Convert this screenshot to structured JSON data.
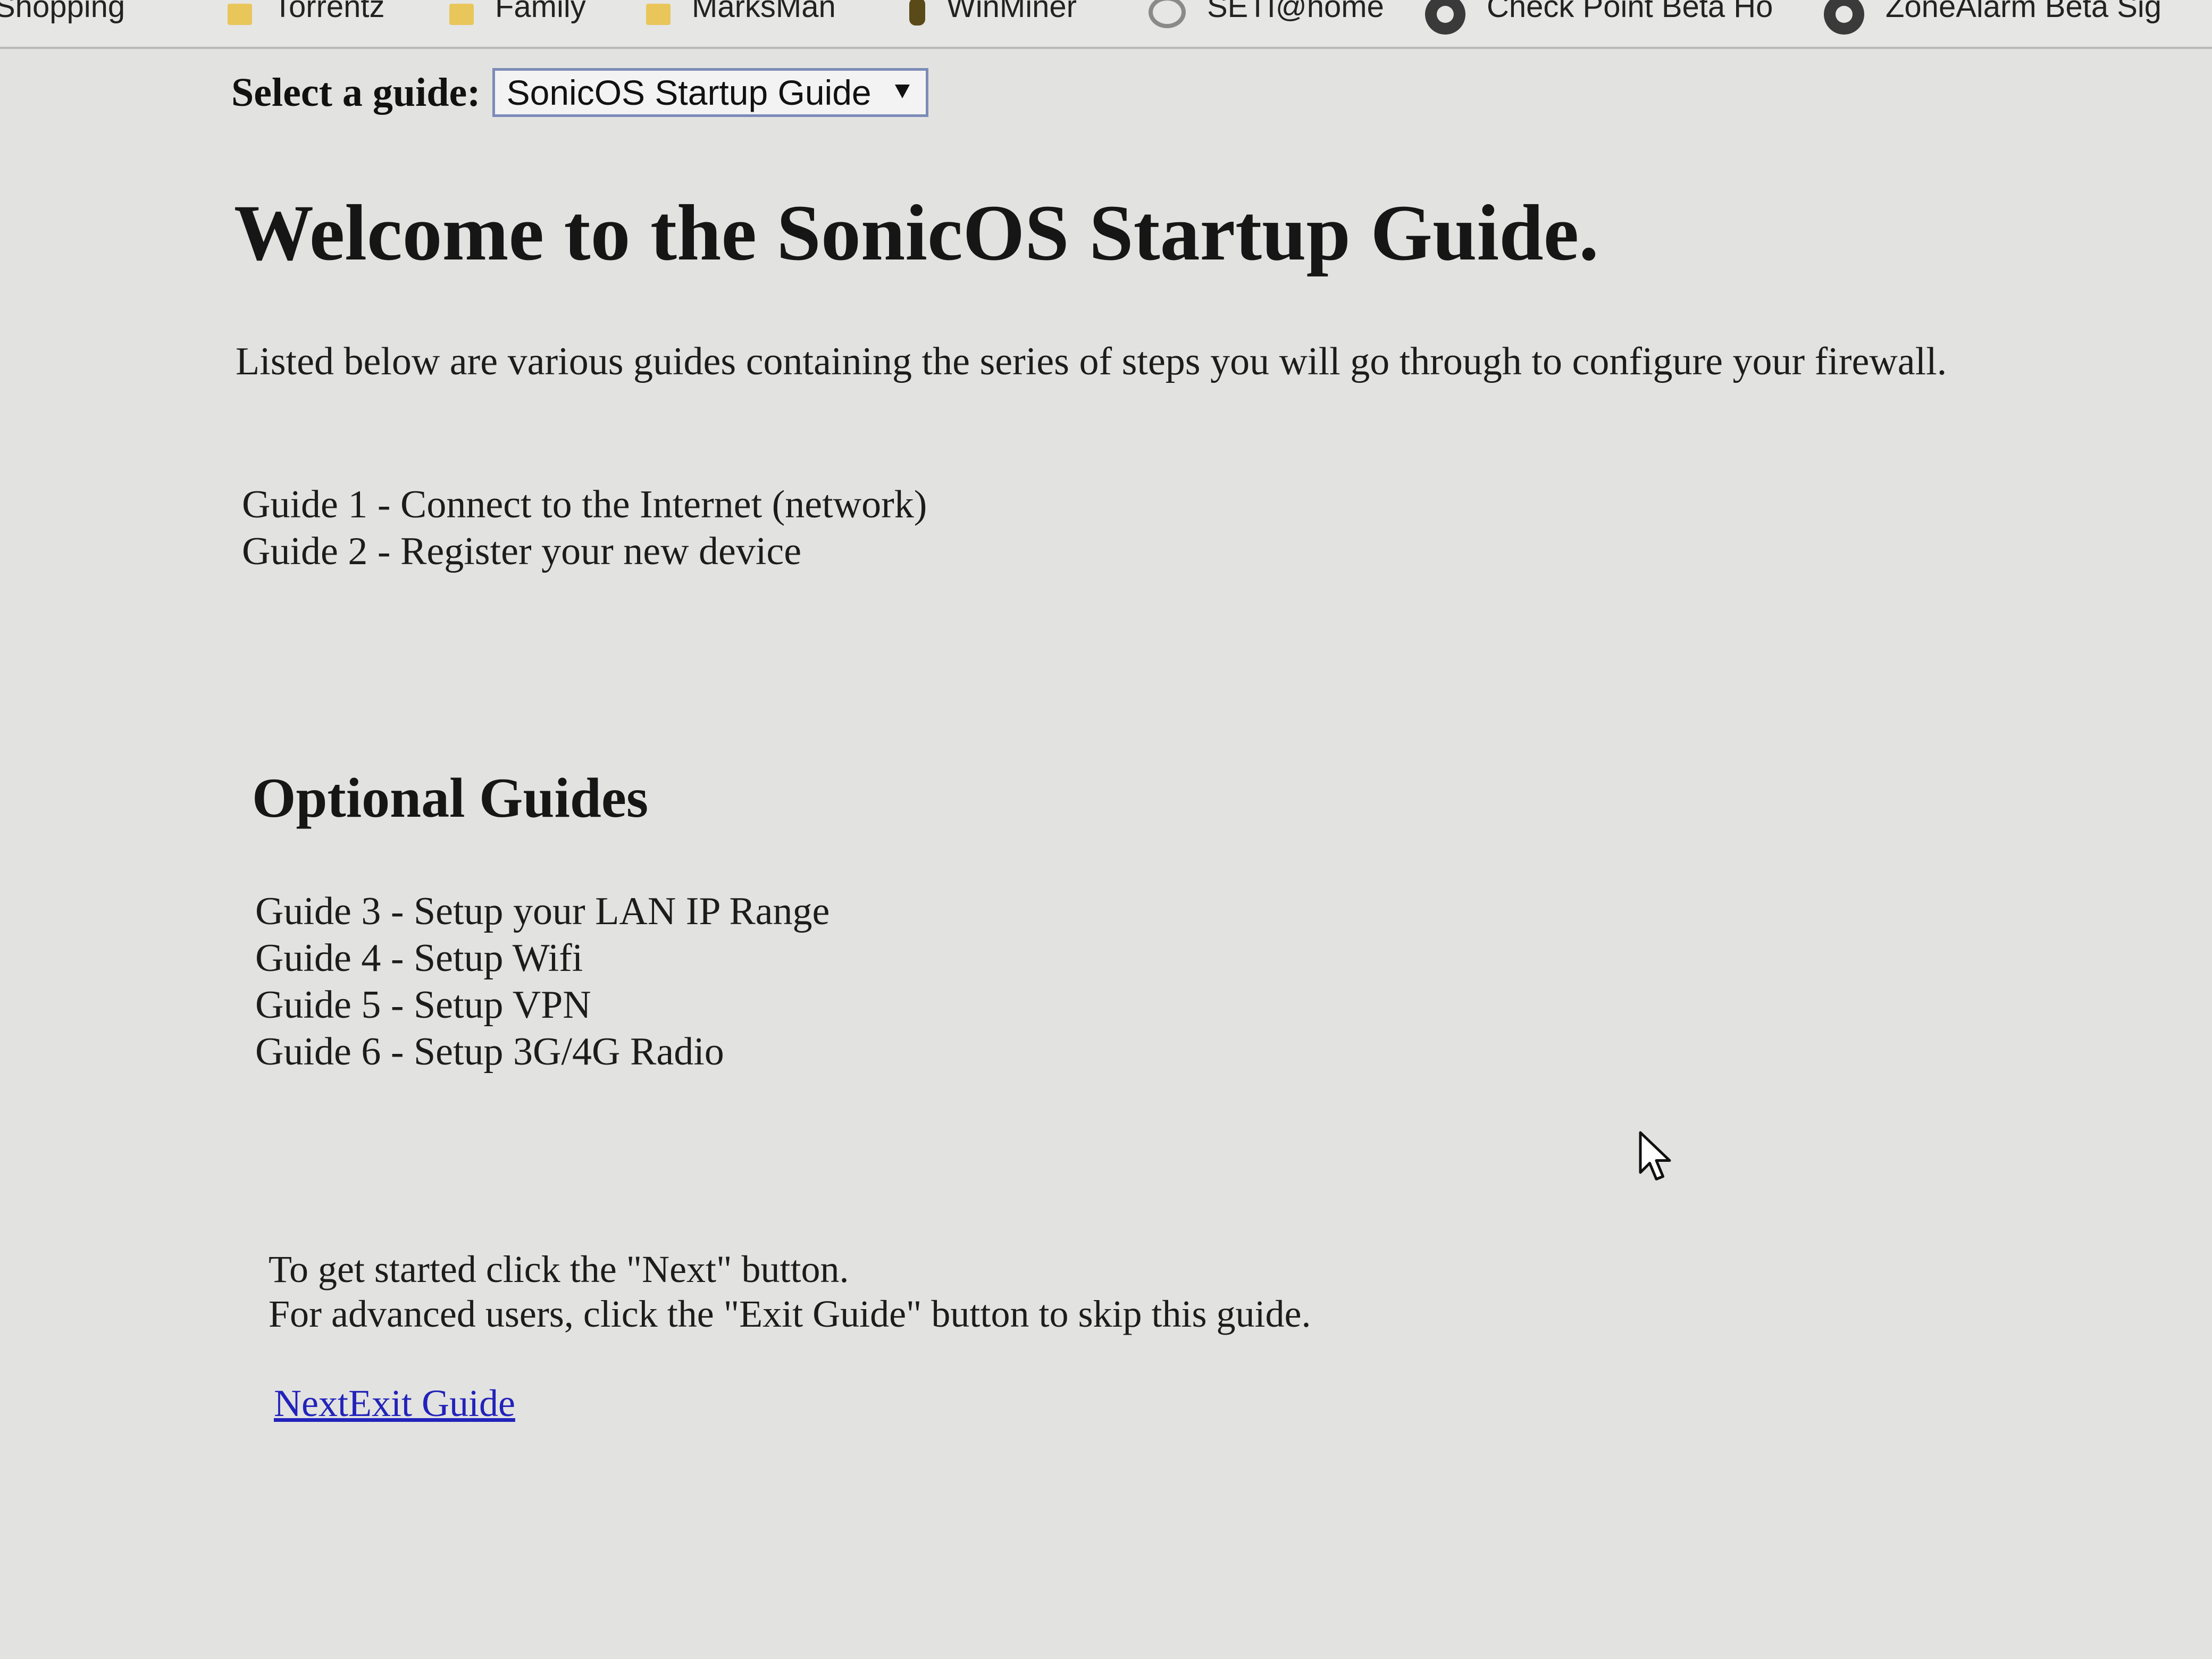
{
  "bookmarks": [
    {
      "label": "Shopping",
      "icon": "folder-icon"
    },
    {
      "label": "Torrentz",
      "icon": "folder-icon"
    },
    {
      "label": "Family",
      "icon": "folder-icon"
    },
    {
      "label": "MarksMan",
      "icon": "folder-icon"
    },
    {
      "label": "WinMiner",
      "icon": "winminer-icon"
    },
    {
      "label": "SETI@home",
      "icon": "seti-icon"
    },
    {
      "label": "Check Point Beta Ho",
      "icon": "checkpoint-icon"
    },
    {
      "label": "ZoneAlarm Beta Sig",
      "icon": "zonealarm-icon"
    }
  ],
  "selector": {
    "label": "Select a guide:",
    "selected": "SonicOS Startup Guide"
  },
  "page": {
    "title": "Welcome to the SonicOS Startup Guide.",
    "intro": "Listed below are various guides containing the series of steps you will go through to configure your firewall.",
    "guides": [
      "Guide 1 - Connect to the Internet (network)",
      "Guide 2 - Register your new device"
    ],
    "optional_title": "Optional Guides",
    "optional_guides": [
      "Guide 3 - Setup your LAN IP Range",
      "Guide 4 - Setup Wifi",
      "Guide 5 - Setup VPN",
      "Guide 6 - Setup 3G/4G Radio"
    ],
    "instructions": [
      "To get started click the \"Next\" button.",
      "For advanced users, click the \"Exit Guide\" button to skip this guide."
    ],
    "next_link": "Next",
    "exit_link": "Exit Guide"
  }
}
